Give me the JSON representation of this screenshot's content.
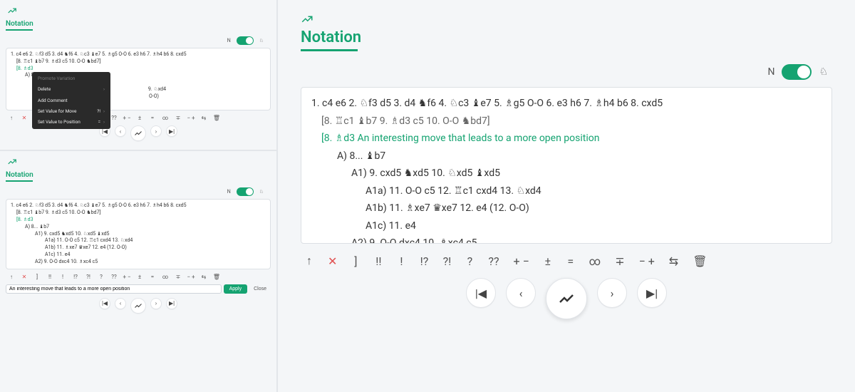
{
  "colors": {
    "accent": "#15a371",
    "panel_bg": "#f4f6f8",
    "card_bg": "#ffffff",
    "text": "#333333",
    "menu_bg": "#2a2a2a",
    "danger": "#e05050"
  },
  "header": {
    "icon": "chart-line-icon",
    "title": "Notation"
  },
  "toggle": {
    "left_label": "N",
    "right_icon_name": "knight-icon",
    "on": true
  },
  "moves": {
    "line1": "1. c4  e6   2. ♘f3  d5   3. d4  ♞f6   4. ♘c3  ♝e7   5. ♗g5  O-O   6. e3  h6   7. ♗h4  b6   8. cxd5",
    "line2": "[8. ♖c1  ♝b7   9. ♗d3  c5   10. O-O  ♞bd7]",
    "line3_open": "[8. ♗d3 An interesting move that leads to a more open position",
    "lA": "A) 8... ♝b7",
    "lA1": "A1) 9. cxd5  ♞xd5   10. ♘xd5  ♝xd5",
    "lA1a": "A1a) 11. O-O  c5   12. ♖c1  cxd4   13. ♘xd4",
    "lA1b": "A1b) 11. ♗xe7  ♛xe7   12. e4 (12. O-O)",
    "lA1c": "A1c) 11. e4",
    "lA2": "A2) 9. O-O  dxc4   10. ♗xc4  c5",
    "mini_line3": "[8. ♗d3",
    "mini_A1_tail": "9. ♘xd4"
  },
  "context_menu": {
    "items": [
      {
        "label": "Promote Variation",
        "enabled": false,
        "submenu": false
      },
      {
        "label": "Delete",
        "enabled": true,
        "submenu": true
      },
      {
        "label": "Add Comment",
        "enabled": true,
        "submenu": false
      },
      {
        "label": "Set Value for Move",
        "enabled": true,
        "submenu": true,
        "hint": "?!"
      },
      {
        "label": "Set Value to Position",
        "enabled": true,
        "submenu": true,
        "hint": "="
      }
    ],
    "mask_tail": "O-O)"
  },
  "annotations": {
    "items": [
      "↑",
      "✕",
      "]",
      "!!",
      "!",
      "!?",
      "?!",
      "?",
      "??",
      "+ −",
      "±",
      "=",
      "∞",
      "∓",
      "− +",
      "⇆",
      "🗑"
    ]
  },
  "nav": {
    "first": "|◀",
    "prev": "‹",
    "analyze_icon": "chart-line-icon",
    "next": "›",
    "last": "▶|"
  },
  "comment_editor": {
    "placeholder": "An interesting move that leads to a more open position",
    "apply": "Apply",
    "close": "Close"
  }
}
